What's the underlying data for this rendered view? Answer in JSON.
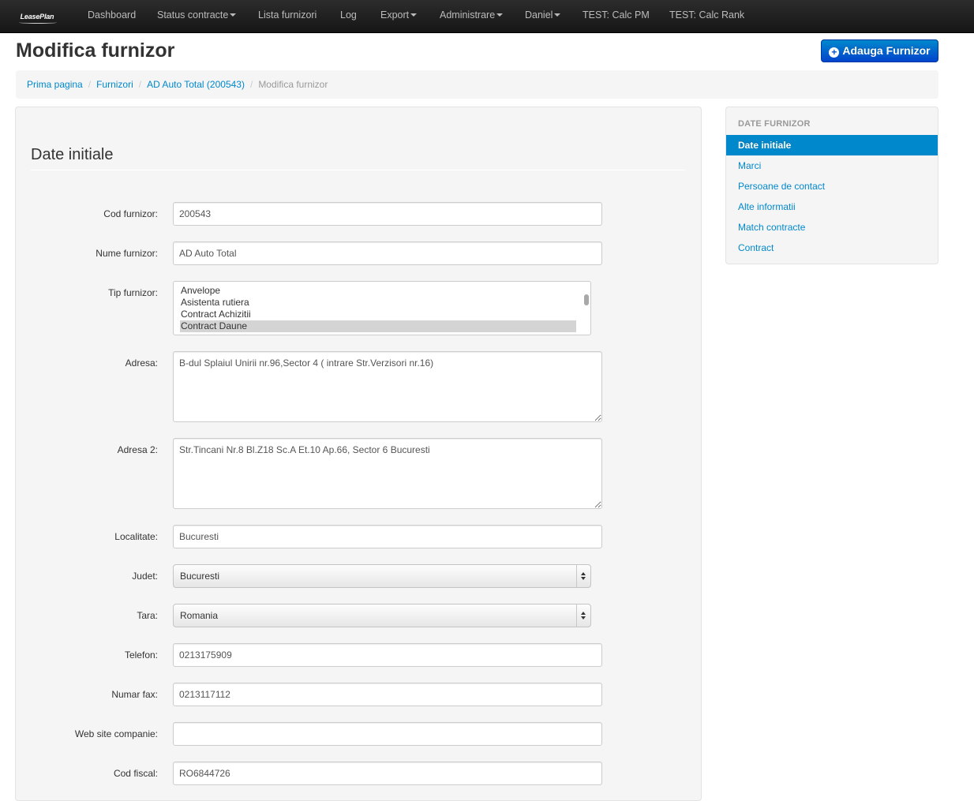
{
  "navbar": {
    "brand": "LeasePlan",
    "items": [
      {
        "label": "Dashboard",
        "dropdown": false
      },
      {
        "label": "Status contracte",
        "dropdown": true
      },
      {
        "label": "Lista furnizori",
        "dropdown": false
      },
      {
        "label": "Log",
        "dropdown": false
      },
      {
        "label": "Export",
        "dropdown": true
      },
      {
        "label": "Administrare",
        "dropdown": true
      },
      {
        "label": "Daniel",
        "dropdown": true
      },
      {
        "label": "TEST: Calc PM",
        "dropdown": false
      },
      {
        "label": "TEST: Calc Rank",
        "dropdown": false
      }
    ]
  },
  "header": {
    "title": "Modifica furnizor",
    "add_button_label": "Adauga Furnizor"
  },
  "breadcrumb": [
    {
      "label": "Prima pagina",
      "link": true
    },
    {
      "label": "Furnizori",
      "link": true
    },
    {
      "label": "AD Auto Total (200543)",
      "link": true
    },
    {
      "label": "Modifica furnizor",
      "link": false
    }
  ],
  "form": {
    "section_title": "Date initiale",
    "cod_furnizor": {
      "label": "Cod furnizor:",
      "value": "200543"
    },
    "nume_furnizor": {
      "label": "Nume furnizor:",
      "value": "AD Auto Total"
    },
    "tip_furnizor": {
      "label": "Tip furnizor:",
      "options": [
        "Anvelope",
        "Asistenta rutiera",
        "Contract Achizitii",
        "Contract Daune"
      ],
      "selected": "Contract Daune"
    },
    "adresa": {
      "label": "Adresa:",
      "value": "B-dul Splaiul Unirii nr.96,Sector 4 ( intrare Str.Verzisori nr.16)"
    },
    "adresa2": {
      "label": "Adresa 2:",
      "value": "Str.Tincani Nr.8 Bl.Z18 Sc.A Et.10 Ap.66, Sector 6 Bucuresti"
    },
    "localitate": {
      "label": "Localitate:",
      "value": "Bucuresti"
    },
    "judet": {
      "label": "Judet:",
      "value": "Bucuresti"
    },
    "tara": {
      "label": "Tara:",
      "value": "Romania"
    },
    "telefon": {
      "label": "Telefon:",
      "value": "0213175909"
    },
    "fax": {
      "label": "Numar fax:",
      "value": "0213117112"
    },
    "website": {
      "label": "Web site companie:",
      "value": ""
    },
    "cod_fiscal": {
      "label": "Cod fiscal:",
      "value": "RO6844726"
    }
  },
  "sidebar": {
    "header": "DATE FURNIZOR",
    "items": [
      {
        "label": "Date initiale",
        "active": true
      },
      {
        "label": "Marci",
        "active": false
      },
      {
        "label": "Persoane de contact",
        "active": false
      },
      {
        "label": "Alte informatii",
        "active": false
      },
      {
        "label": "Match contracte",
        "active": false
      },
      {
        "label": "Contract",
        "active": false
      }
    ]
  },
  "colors": {
    "navbar": "#1b1b1b",
    "accent": "#0088cc",
    "primary_button": "#0055cc"
  }
}
